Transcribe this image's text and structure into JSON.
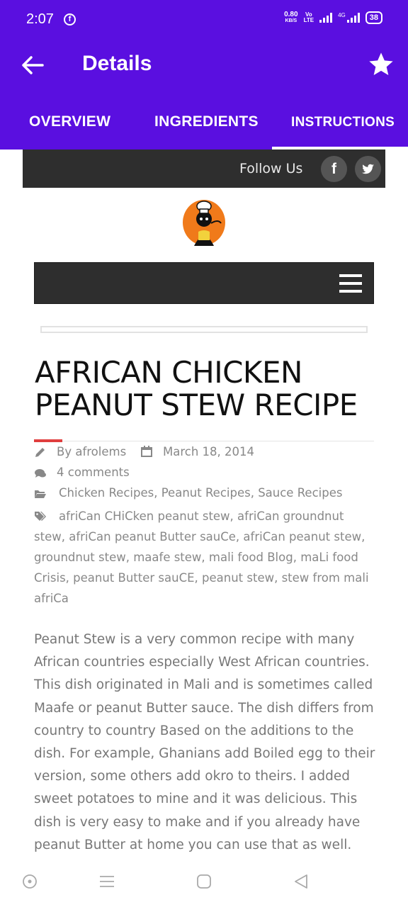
{
  "status": {
    "time": "2:07",
    "net_speed_value": "0.80",
    "net_speed_unit": "KB/S",
    "volte_top": "Vo",
    "volte_bottom": "LTE",
    "network": "4G",
    "battery": "38"
  },
  "app_bar": {
    "title": "Details",
    "tabs": [
      {
        "label": "OVERVIEW"
      },
      {
        "label": "INGREDIENTS"
      },
      {
        "label": "INSTRUCTIONS"
      }
    ],
    "active_tab": "INSTRUCTIONS"
  },
  "follow_bar": {
    "label": "Follow Us",
    "facebook_glyph": "f",
    "icons": [
      "facebook-icon",
      "twitter-icon"
    ]
  },
  "post": {
    "title": "AFRICAN CHICKEN PEANUT STEW RECIPE",
    "author": "By afrolems",
    "date": "March 18, 2014",
    "comments": "4 comments",
    "categories": "Chicken Recipes, Peanut Recipes, Sauce Recipes",
    "tags": "afriCan CHiCken peanut stew, afriCan groundnut stew, afriCan peanut Butter sauCe, afriCan peanut stew, groundnut stew, maafe stew, mali food Blog, maLi food Crisis, peanut Butter sauCE, peanut stew, stew from mali afriCa",
    "body": "Peanut Stew is a very common recipe with many African countries especially West African countries. This dish originated in Mali and is sometimes called Maafe or peanut Butter sauce. The dish differs from country to country Based on the additions to the dish. For example, Ghanians add Boiled egg to their version, some others add okro to theirs. I added sweet potatoes to mine and it was delicious. This dish is very easy to make and if you already have peanut Butter at home you can use that as well."
  },
  "colors": {
    "primary": "#5a0fe0",
    "dark_bar": "#2e2e2e",
    "accent": "#e03e3e",
    "text_muted": "#777777"
  }
}
